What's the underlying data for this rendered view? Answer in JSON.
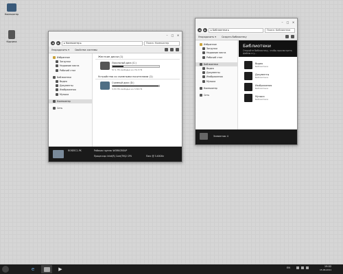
{
  "desktop": {
    "icons": [
      {
        "label": "Компьютер",
        "icon": "computer-icon"
      },
      {
        "label": "Корзина",
        "icon": "recycle-bin-icon"
      }
    ]
  },
  "computer_window": {
    "path": "▸ Компьютер ▸",
    "search_placeholder": "Поиск: Компьютер",
    "toolbar": {
      "organize": "Упорядочить ▾",
      "system_props": "Свойства системы"
    },
    "nav": {
      "favorites": "Избранное",
      "fav_items": [
        "Загрузки",
        "Недавние места",
        "Рабочий стол"
      ],
      "libraries": "Библиотеки",
      "lib_items": [
        "Видео",
        "Документы",
        "Изображения",
        "Музыка"
      ],
      "computer": "Компьютер",
      "network": "Сеть"
    },
    "hdd_section": "Жесткие диски (1)",
    "removable_section": "Устройства со съемными носителями (1)",
    "drives": [
      {
        "name": "Локальный диск (C:)",
        "free": "57,1 ГБ свободно из 74,3 ГБ",
        "used_fraction": 0.23
      },
      {
        "name": "Съемный диск (D:)",
        "free": "3,53 ГБ свободно из 3,56 ГБ",
        "used_fraction": 0.99
      }
    ],
    "details": {
      "name": "ROSEEC1-PK",
      "workgroup": "Рабочая группа: WORKGROUP",
      "cpu": "Процессор: Intel(R) Core(TM)2 CPU",
      "memory": "Пам: @ 3.40GHz"
    }
  },
  "libraries_window": {
    "path": "▸ Библиотеки ▸",
    "search_placeholder": "Поиск: Библиотеки",
    "toolbar": {
      "organize": "Упорядочить ▾",
      "new_library": "Создать библиотеку"
    },
    "header": {
      "title": "Библиотеки",
      "subtitle": "Откройте библиотеку, чтобы просмотреть файлы и у..."
    },
    "nav": {
      "favorites": "Избранное",
      "fav_items": [
        "Загрузки",
        "Недавние места",
        "Рабочий стол"
      ],
      "libraries": "Библиотеки",
      "lib_items": [
        "Видео",
        "Документы",
        "Изображения",
        "Музыка"
      ],
      "computer": "Компьютер",
      "network": "Сеть"
    },
    "items": [
      {
        "name": "Видео",
        "kind": "Библиотека"
      },
      {
        "name": "Документы",
        "kind": "Библиотека"
      },
      {
        "name": "Изображения",
        "kind": "Библиотека"
      },
      {
        "name": "Музыка",
        "kind": "Библиотека"
      }
    ],
    "details": {
      "count": "Элементов: 4"
    }
  },
  "taskbar": {
    "language": "EN",
    "time": "19:02",
    "date": "15.06.2011"
  },
  "colors": {
    "accent_dark": "#1a1a1a",
    "desktop_bg": "#d6d6d6"
  }
}
